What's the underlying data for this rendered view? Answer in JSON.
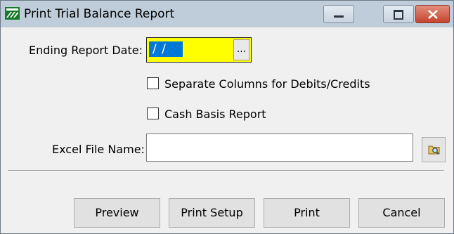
{
  "window": {
    "title": "Print Trial Balance Report",
    "icon": "app-logo-icon"
  },
  "controls": {
    "minimize": "minimize-icon",
    "maximize": "maximize-icon",
    "close": "close-icon"
  },
  "form": {
    "ending_date_label": "Ending Report Date:",
    "ending_date_value": "/ /",
    "date_picker_label": "...",
    "separate_columns_label": "Separate Columns for Debits/Credits",
    "separate_columns_checked": false,
    "cash_basis_label": "Cash Basis Report",
    "cash_basis_checked": false,
    "excel_label": "Excel File Name:",
    "excel_value": "",
    "browse_icon": "folder-search-icon"
  },
  "buttons": {
    "preview": "Preview",
    "print_setup": "Print Setup",
    "print": "Print",
    "cancel": "Cancel"
  },
  "colors": {
    "date_field_bg": "#ffff00",
    "selection": "#0078d7",
    "close_button": "#c4432e"
  }
}
